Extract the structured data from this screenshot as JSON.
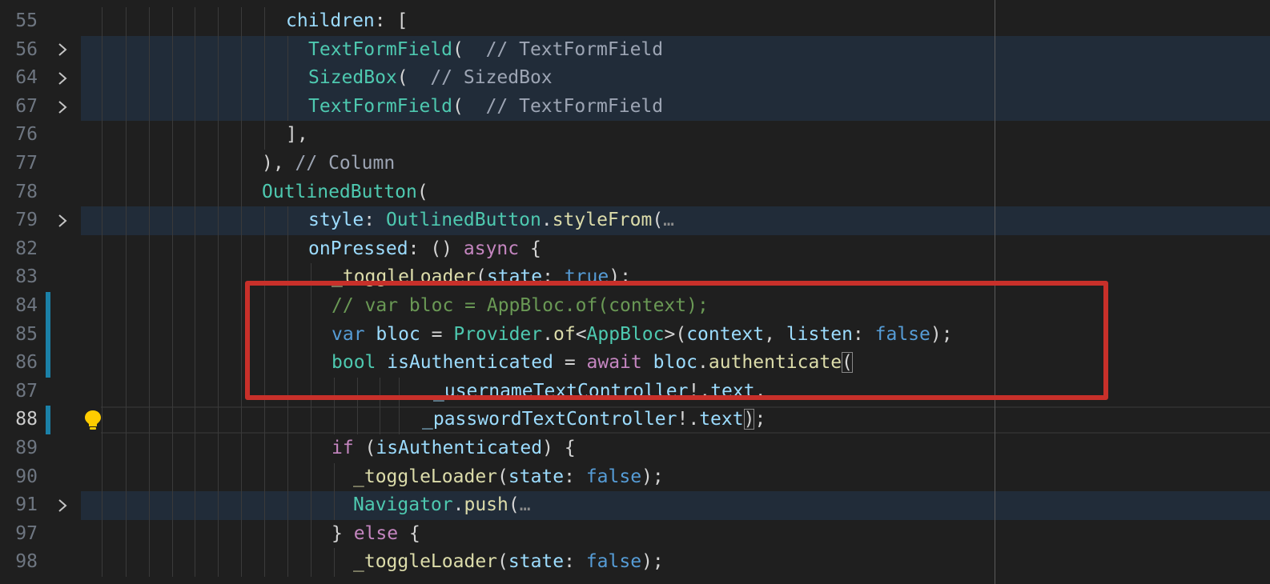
{
  "editor": {
    "lines": [
      {
        "num": "55",
        "code": [
          {
            "t": "children",
            "c": "c-var"
          },
          {
            "t": ": ["
          }
        ]
      },
      {
        "num": "56",
        "folded": true,
        "code": [
          {
            "t": "TextFormField",
            "c": "c-cls"
          },
          {
            "t": "( "
          },
          {
            "t": " // TextFormField",
            "c": "c-grey"
          }
        ]
      },
      {
        "num": "64",
        "folded": true,
        "code": [
          {
            "t": "SizedBox",
            "c": "c-cls"
          },
          {
            "t": "( "
          },
          {
            "t": " // SizedBox",
            "c": "c-grey"
          }
        ]
      },
      {
        "num": "67",
        "folded": true,
        "code": [
          {
            "t": "TextFormField",
            "c": "c-cls"
          },
          {
            "t": "( "
          },
          {
            "t": " // TextFormField",
            "c": "c-grey"
          }
        ]
      },
      {
        "num": "76",
        "code": [
          {
            "t": "],"
          }
        ]
      },
      {
        "num": "77",
        "code": [
          {
            "t": "), "
          },
          {
            "t": "// Column",
            "c": "c-grey"
          }
        ]
      },
      {
        "num": "78",
        "code": [
          {
            "t": "OutlinedButton",
            "c": "c-cls"
          },
          {
            "t": "("
          }
        ]
      },
      {
        "num": "79",
        "folded": true,
        "code": [
          {
            "t": "style",
            "c": "c-var"
          },
          {
            "t": ": "
          },
          {
            "t": "OutlinedButton",
            "c": "c-cls"
          },
          {
            "t": "."
          },
          {
            "t": "styleFrom",
            "c": "c-fn"
          },
          {
            "t": "("
          },
          {
            "t": "…",
            "c": "c-ell"
          }
        ]
      },
      {
        "num": "82",
        "code": [
          {
            "t": "onPressed",
            "c": "c-var"
          },
          {
            "t": ": () "
          },
          {
            "t": "async",
            "c": "c-kw"
          },
          {
            "t": " {"
          }
        ]
      },
      {
        "num": "83",
        "code": [
          {
            "t": "_toggleLoader",
            "c": "c-fn"
          },
          {
            "t": "("
          },
          {
            "t": "state",
            "c": "c-var"
          },
          {
            "t": ": "
          },
          {
            "t": "true",
            "c": "c-kw2"
          },
          {
            "t": ");"
          }
        ]
      },
      {
        "num": "84",
        "git": true,
        "code": [
          {
            "t": "// var bloc = AppBloc.of(context);",
            "c": "c-cmt"
          }
        ]
      },
      {
        "num": "85",
        "git": true,
        "code": [
          {
            "t": "var",
            "c": "c-kw2"
          },
          {
            "t": " "
          },
          {
            "t": "bloc",
            "c": "c-var"
          },
          {
            "t": " = "
          },
          {
            "t": "Provider",
            "c": "c-cls"
          },
          {
            "t": "."
          },
          {
            "t": "of",
            "c": "c-fn"
          },
          {
            "t": "<"
          },
          {
            "t": "AppBloc",
            "c": "c-cls"
          },
          {
            "t": ">("
          },
          {
            "t": "context",
            "c": "c-var"
          },
          {
            "t": ", "
          },
          {
            "t": "listen",
            "c": "c-var"
          },
          {
            "t": ": "
          },
          {
            "t": "false",
            "c": "c-kw2"
          },
          {
            "t": ");"
          }
        ]
      },
      {
        "num": "86",
        "git": true,
        "code": [
          {
            "t": "bool",
            "c": "c-cls"
          },
          {
            "t": " "
          },
          {
            "t": "isAuthenticated",
            "c": "c-var"
          },
          {
            "t": " = "
          },
          {
            "t": "await",
            "c": "c-kw"
          },
          {
            "t": " "
          },
          {
            "t": "bloc",
            "c": "c-var"
          },
          {
            "t": "."
          },
          {
            "t": "authenticate",
            "c": "c-fn"
          },
          {
            "t": "(",
            "c": "bm"
          }
        ]
      },
      {
        "num": "87",
        "code": [
          {
            "t": "_usernameTextController",
            "c": "c-var"
          },
          {
            "t": "!."
          },
          {
            "t": "text",
            "c": "c-var"
          },
          {
            "t": ","
          }
        ]
      },
      {
        "num": "88",
        "git": true,
        "current": true,
        "bulb": true,
        "code": [
          {
            "t": "_passwordTextController",
            "c": "c-var"
          },
          {
            "t": "!."
          },
          {
            "t": "text",
            "c": "c-var"
          },
          {
            "t": ")",
            "c": "bm"
          },
          {
            "t": ";"
          }
        ]
      },
      {
        "num": "89",
        "code": [
          {
            "t": "if",
            "c": "c-kw"
          },
          {
            "t": " ("
          },
          {
            "t": "isAuthenticated",
            "c": "c-var"
          },
          {
            "t": ") {"
          }
        ]
      },
      {
        "num": "90",
        "code": [
          {
            "t": "_toggleLoader",
            "c": "c-fn"
          },
          {
            "t": "("
          },
          {
            "t": "state",
            "c": "c-var"
          },
          {
            "t": ": "
          },
          {
            "t": "false",
            "c": "c-kw2"
          },
          {
            "t": ");"
          }
        ]
      },
      {
        "num": "91",
        "folded": true,
        "code": [
          {
            "t": "Navigator",
            "c": "c-cls"
          },
          {
            "t": "."
          },
          {
            "t": "push",
            "c": "c-fn"
          },
          {
            "t": "("
          },
          {
            "t": "…",
            "c": "c-ell"
          }
        ]
      },
      {
        "num": "97",
        "code": [
          {
            "t": "} "
          },
          {
            "t": "else",
            "c": "c-kw"
          },
          {
            "t": " {"
          }
        ]
      },
      {
        "num": "98",
        "code": [
          {
            "t": "_toggleLoader",
            "c": "c-fn"
          },
          {
            "t": "("
          },
          {
            "t": "state",
            "c": "c-var"
          },
          {
            "t": ": "
          },
          {
            "t": "false",
            "c": "c-kw2"
          },
          {
            "t": ");"
          }
        ]
      }
    ],
    "colors": {
      "background": "#1f1f1f",
      "folded_line": "#212c39",
      "git_modified": "#1b81a8",
      "annotation_box": "#c8302a"
    },
    "icons": [
      "chevron-right-icon",
      "lightbulb-icon"
    ]
  }
}
